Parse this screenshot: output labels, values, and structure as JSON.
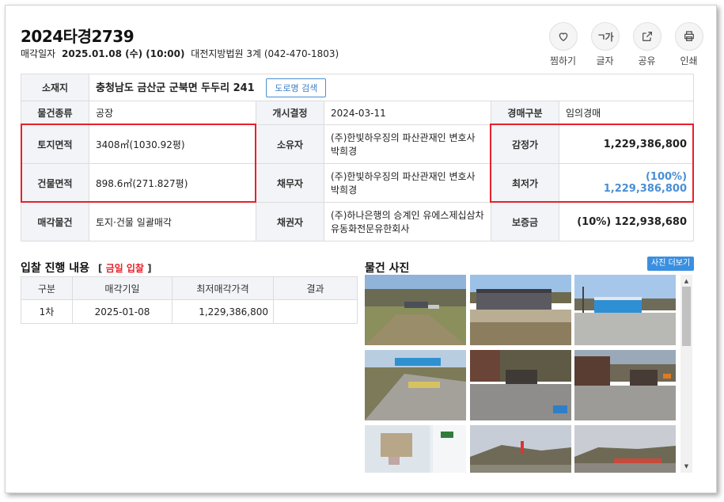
{
  "header": {
    "case_no": "2024타경2739",
    "sale_label": "매각일자",
    "sale_date": "2025.01.08 (수) (10:00)",
    "court_info": "대전지방법원 3계 (042-470-1803)"
  },
  "actions": [
    {
      "label": "찜하기",
      "icon": "heart-icon"
    },
    {
      "label": "글자",
      "icon": "text-size-icon",
      "glyph": "ㄱ가"
    },
    {
      "label": "공유",
      "icon": "share-icon"
    },
    {
      "label": "인쇄",
      "icon": "print-icon"
    }
  ],
  "info": {
    "location_label": "소재지",
    "location_value": "충청남도 금산군 군북면 두두리 241",
    "road_button": "도로명 검색",
    "type_label": "물건종류",
    "type_value": "공장",
    "start_label": "개시결정",
    "start_value": "2024-03-11",
    "auction_label": "경매구분",
    "auction_value": "임의경매",
    "land_label": "토지면적",
    "land_value": "3408㎡(1030.92평)",
    "owner_label": "소유자",
    "owner_value": "(주)한빛하우징의 파산관재인 변호사 박희경",
    "appraisal_label": "감정가",
    "appraisal_value": "1,229,386,800",
    "building_label": "건물면적",
    "building_value": "898.6㎡(271.827평)",
    "debtor_label": "채무자",
    "debtor_value": "(주)한빛하우징의 파산관재인 변호사 박희경",
    "min_label": "최저가",
    "min_value": "(100%) 1,229,386,800",
    "sale_obj_label": "매각물건",
    "sale_obj_value": "토지·건물 일괄매각",
    "creditor_label": "채권자",
    "creditor_value": "(주)하나은행의 승계인 유에스제십삼차유동화전문유한회사",
    "deposit_label": "보증금",
    "deposit_value": "(10%) 122,938,680"
  },
  "bid": {
    "title": "입찰 진행 내용",
    "tag_open": "[",
    "tag_text": "금일 입찰",
    "tag_close": "]",
    "headers": [
      "구분",
      "매각기일",
      "최저매각가격",
      "결과"
    ],
    "rows": [
      {
        "round": "1차",
        "date": "2025-01-08",
        "price": "1,229,386,800",
        "result": ""
      }
    ]
  },
  "photos": {
    "title": "물건 사진",
    "more_button": "사진 더보기"
  },
  "colors": {
    "highlight_border": "#e8202a",
    "accent_blue": "#4a8fd4",
    "header_bg": "#f2f4f7"
  }
}
